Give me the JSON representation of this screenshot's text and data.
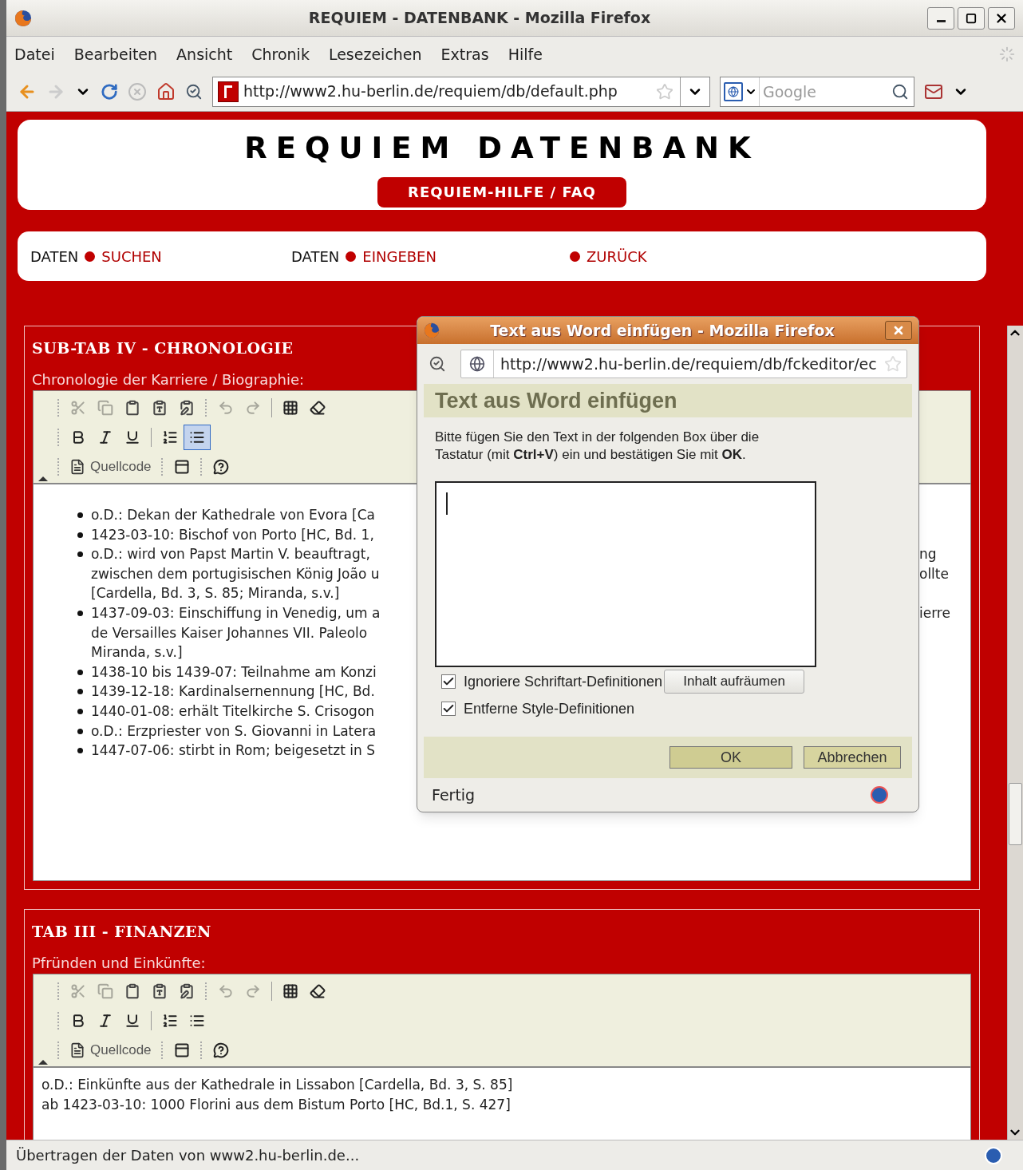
{
  "window": {
    "title": "REQUIEM - DATENBANK - Mozilla Firefox"
  },
  "menu": [
    {
      "label": "Datei"
    },
    {
      "label": "Bearbeiten"
    },
    {
      "label": "Ansicht"
    },
    {
      "label": "Chronik"
    },
    {
      "label": "Lesezeichen"
    },
    {
      "label": "Extras"
    },
    {
      "label": "Hilfe"
    }
  ],
  "navigation": {
    "forward_disabled": true,
    "stop_disabled": true,
    "url": "http://www2.hu-berlin.de/requiem/db/default.php",
    "search_placeholder": "Google"
  },
  "page": {
    "title": "REQUIEM DATENBANK",
    "help_button": "REQUIEM-HILFE / FAQ",
    "nav": [
      {
        "prefix": "DATEN",
        "link": "SUCHEN"
      },
      {
        "prefix": "DATEN",
        "link": "EINGEBEN"
      },
      {
        "link": "ZURÜCK"
      }
    ]
  },
  "sections": [
    {
      "title": "SUB-TAB IV - CHRONOLOGIE",
      "label": "Chronologie der Karriere / Biographie:",
      "toolbar": [
        [
          {
            "kind": "grip"
          },
          {
            "kind": "cut",
            "disabled": true
          },
          {
            "kind": "copy",
            "disabled": true
          },
          {
            "kind": "paste",
            "disabled": false
          },
          {
            "kind": "paste-text",
            "disabled": false
          },
          {
            "kind": "paste-word",
            "disabled": false
          },
          {
            "kind": "grip"
          },
          {
            "kind": "undo",
            "disabled": true
          },
          {
            "kind": "redo",
            "disabled": true
          },
          {
            "kind": "separator"
          },
          {
            "kind": "select-all",
            "disabled": false
          },
          {
            "kind": "remove-format",
            "disabled": false
          }
        ],
        [
          {
            "kind": "grip"
          },
          {
            "kind": "bold",
            "selected": false
          },
          {
            "kind": "italic",
            "selected": false
          },
          {
            "kind": "underline",
            "selected": false
          },
          {
            "kind": "separator"
          },
          {
            "kind": "ordered-list",
            "selected": false
          },
          {
            "kind": "bullet-list",
            "selected": true
          }
        ],
        [
          {
            "kind": "grip"
          },
          {
            "kind": "source",
            "label": "Quellcode"
          },
          {
            "kind": "grip"
          },
          {
            "kind": "show-blocks",
            "disabled": false
          },
          {
            "kind": "grip"
          },
          {
            "kind": "help",
            "disabled": false
          }
        ]
      ],
      "body": {
        "kind": "list",
        "items": [
          {
            "lines": [
              {
                "text": "o.D.: Dekan der Kathedrale von Evora [Ca"
              }
            ]
          },
          {
            "lines": [
              {
                "text": "1423-03-10: Bischof von Porto [HC, Bd. 1,"
              }
            ]
          },
          {
            "lines": [
              {
                "text": "o.D.: wird von Papst Martin V. beauftragt,",
                "tail": "ng"
              },
              {
                "text": "zwischen dem portugisischen König João u",
                "tail": "ollte"
              },
              {
                "text": "[Cardella, Bd. 3, S. 85; Miranda, s.v.]"
              }
            ]
          },
          {
            "lines": [
              {
                "text": "1437-09-03: Einschiffung in Venedig, um a",
                "tail": "ierre"
              },
              {
                "text": "de Versailles Kaiser Johannes VII. Paleolo"
              },
              {
                "text": "Miranda, s.v.]"
              }
            ]
          },
          {
            "lines": [
              {
                "text": "1438-10 bis 1439-07: Teilnahme am Konzi"
              }
            ]
          },
          {
            "lines": [
              {
                "text": "1439-12-18: Kardinalsernennung [HC, Bd."
              }
            ]
          },
          {
            "lines": [
              {
                "text": "1440-01-08: erhält Titelkirche S. Crisogon"
              }
            ]
          },
          {
            "lines": [
              {
                "text": "o.D.: Erzpriester von S. Giovanni in Latera"
              }
            ]
          },
          {
            "lines": [
              {
                "text": "1447-07-06: stirbt in Rom; beigesetzt in S"
              }
            ]
          }
        ]
      }
    },
    {
      "title": "TAB III - FINANZEN",
      "label": "Pfründen und Einkünfte:",
      "toolbar": [
        [
          {
            "kind": "grip"
          },
          {
            "kind": "cut",
            "disabled": true
          },
          {
            "kind": "copy",
            "disabled": true
          },
          {
            "kind": "paste",
            "disabled": false
          },
          {
            "kind": "paste-text",
            "disabled": false
          },
          {
            "kind": "paste-word",
            "disabled": false
          },
          {
            "kind": "grip"
          },
          {
            "kind": "undo",
            "disabled": true
          },
          {
            "kind": "redo",
            "disabled": true
          },
          {
            "kind": "separator"
          },
          {
            "kind": "select-all",
            "disabled": false
          },
          {
            "kind": "remove-format",
            "disabled": false
          }
        ],
        [
          {
            "kind": "grip"
          },
          {
            "kind": "bold",
            "selected": false
          },
          {
            "kind": "italic",
            "selected": false
          },
          {
            "kind": "underline",
            "selected": false
          },
          {
            "kind": "separator"
          },
          {
            "kind": "ordered-list",
            "selected": false
          },
          {
            "kind": "bullet-list",
            "selected": false
          }
        ],
        [
          {
            "kind": "grip"
          },
          {
            "kind": "source",
            "label": "Quellcode"
          },
          {
            "kind": "grip"
          },
          {
            "kind": "show-blocks",
            "disabled": false
          },
          {
            "kind": "grip"
          },
          {
            "kind": "help",
            "disabled": false
          }
        ]
      ],
      "body": {
        "kind": "paragraphs",
        "lines": [
          "o.D.: Einkünfte aus der Kathedrale in Lissabon [Cardella, Bd. 3, S. 85]",
          "ab 1423-03-10: 1000 Florini aus dem Bistum Porto [HC, Bd.1, S. 427]"
        ]
      }
    }
  ],
  "dialog": {
    "window_title": "Text aus Word einfügen - Mozilla Firefox",
    "url": "http://www2.hu-berlin.de/requiem/db/fckeditor/ec",
    "heading": "Text aus Word einfügen",
    "instructions": "Bitte fügen Sie den Text in der folgenden Box über die Tastatur (mit **Ctrl+V**) ein und bestätigen Sie mit **OK**.",
    "options": [
      {
        "label": "Ignoriere Schriftart-Definitionen",
        "checked": true
      },
      {
        "label": "Entferne Style-Definitionen",
        "checked": true
      }
    ],
    "cleanup_button": "Inhalt aufräumen",
    "ok_button": "OK",
    "cancel_button": "Abbrechen",
    "status": "Fertig"
  },
  "status_bar": "Übertragen der Daten von www2.hu-berlin.de..."
}
